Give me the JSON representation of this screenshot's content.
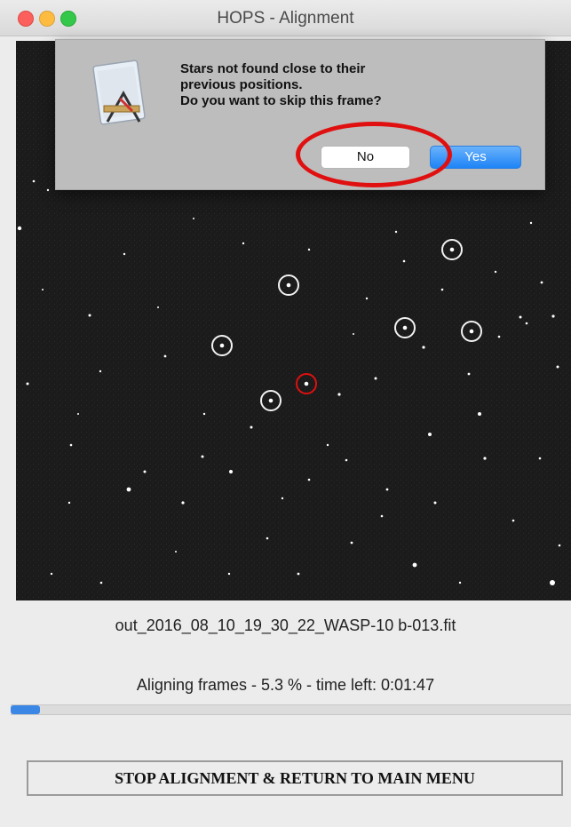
{
  "window": {
    "title": "HOPS - Alignment",
    "controls": [
      "close",
      "minimize",
      "maximize"
    ]
  },
  "dialog": {
    "message": "Stars not found close to their\nprevious positions.\nDo you want to skip this frame?",
    "icon": "script-editor-app-icon",
    "no_label": "No",
    "yes_label": "Yes",
    "default_button": "Yes",
    "highlight_color": "#e01010"
  },
  "image": {
    "description_icon": "star-field-image",
    "tracked_stars": 7,
    "target_marker_color": "#e01010"
  },
  "filename": "out_2016_08_10_19_30_22_WASP-10 b-013.fit",
  "status": "Aligning frames - 5.3 % - time left: 0:01:47",
  "progress": {
    "value": 0.053,
    "color": "#3b87e5"
  },
  "stop_button": "STOP ALIGNMENT & RETURN TO MAIN MENU"
}
